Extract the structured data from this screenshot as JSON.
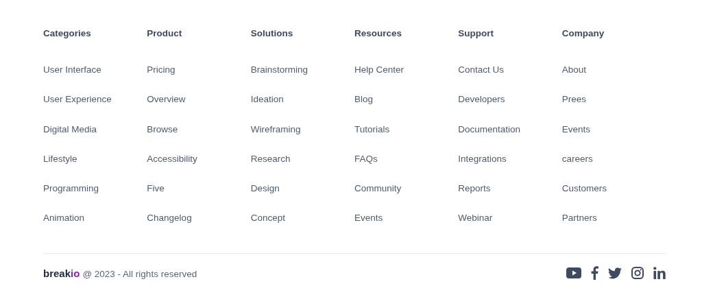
{
  "columns": [
    {
      "heading": "Categories",
      "links": [
        "User Interface",
        "User Experience",
        "Digital Media",
        "Lifestyle",
        "Programming",
        "Animation"
      ]
    },
    {
      "heading": "Product",
      "links": [
        "Pricing",
        "Overview",
        "Browse",
        "Accessibility",
        "Five",
        "Changelog"
      ]
    },
    {
      "heading": "Solutions",
      "links": [
        "Brainstorming",
        "Ideation",
        "Wireframing",
        "Research",
        "Design",
        "Concept"
      ]
    },
    {
      "heading": "Resources",
      "links": [
        "Help Center",
        "Blog",
        "Tutorials",
        "FAQs",
        "Community",
        "Events"
      ]
    },
    {
      "heading": "Support",
      "links": [
        "Contact Us",
        "Developers",
        "Documentation",
        "Integrations",
        "Reports",
        "Webinar"
      ]
    },
    {
      "heading": "Company",
      "links": [
        "About",
        "Prees",
        "Events",
        "careers",
        "Customers",
        "Partners"
      ]
    }
  ],
  "footer": {
    "logo": {
      "text": "break",
      "accent": "io"
    },
    "copyright": "@ 2023 - All rights reserved",
    "social": [
      {
        "kind": "youtube"
      },
      {
        "kind": "facebook"
      },
      {
        "kind": "twitter"
      },
      {
        "kind": "instagram"
      },
      {
        "kind": "linkedin"
      }
    ]
  }
}
